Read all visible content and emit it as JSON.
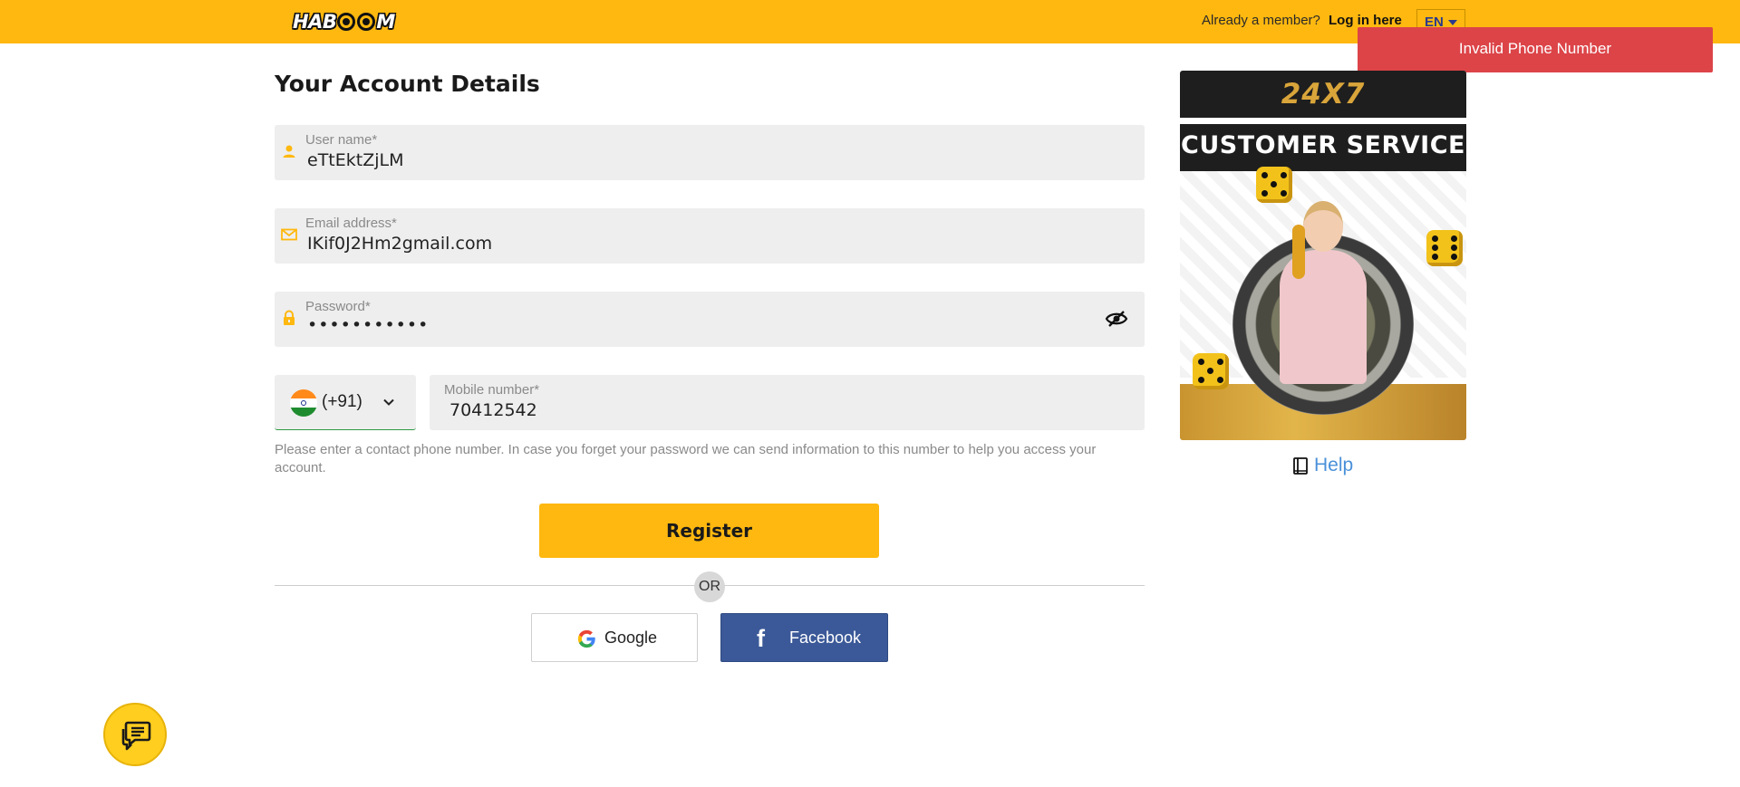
{
  "header": {
    "logo_text": "HABOOM",
    "member_text": "Already a member?",
    "login_link": "Log in here",
    "language": "EN"
  },
  "toast": {
    "message": "Invalid Phone Number",
    "color": "#DC4448"
  },
  "form": {
    "title": "Your Account Details",
    "username": {
      "label": "User name*",
      "value": "eTtEktZjLM",
      "icon": "user-icon"
    },
    "email": {
      "label": "Email address*",
      "value": "IKif0J2Hm2gmail.com",
      "icon": "envelope-icon"
    },
    "password": {
      "label": "Password*",
      "value": "•••••••••••",
      "icon": "lock-icon",
      "toggle_icon": "eye-slash-icon"
    },
    "phone": {
      "country_code": "(+91)",
      "flag": "india-flag-icon",
      "label": "Mobile number*",
      "value": "70412542"
    },
    "help_text": "Please enter a contact phone number. In case you forget your password we can send information to this number to help you access your account.",
    "register_label": "Register",
    "or_label": "OR",
    "google_label": "Google",
    "facebook_label": "Facebook"
  },
  "banner": {
    "line1": "24X7",
    "line2": "CUSTOMER SERVICE"
  },
  "sidebar": {
    "help_label": "Help"
  },
  "colors": {
    "brand": "#FFB80F",
    "facebook": "#3B5998",
    "link": "#4a90d9"
  }
}
